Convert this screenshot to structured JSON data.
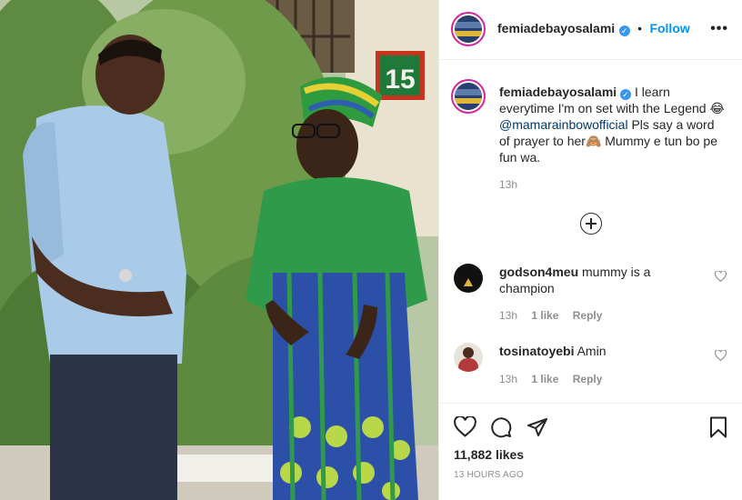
{
  "post": {
    "username": "femiadebayosalami",
    "verified_glyph": "✓",
    "dot": "•",
    "follow_label": "Follow",
    "more_label": "•••",
    "house_number": "15",
    "caption_before": "I learn everytime I'm on set with the Legend 😂 ",
    "caption_mention": "@mamarainbowofficial",
    "caption_after": " Pls say a word of prayer to her🙈 Mummy e tun bo pe fun wa.",
    "caption_time": "13h",
    "load_more_icon": "plus-circle-icon"
  },
  "comments": [
    {
      "username": "godson4meu",
      "text": "mummy is a champion",
      "time": "13h",
      "likes": "1 like",
      "reply": "Reply"
    },
    {
      "username": "tosinatoyebi",
      "text": "Amin",
      "time": "13h",
      "likes": "1 like",
      "reply": "Reply"
    }
  ],
  "actions": {
    "icons": [
      "heart-icon",
      "comment-icon",
      "share-icon",
      "bookmark-icon"
    ],
    "likes": "11,882 likes",
    "posted": "13 HOURS AGO"
  },
  "colors": {
    "accent": "#0095f6",
    "verified": "#3897f0",
    "mention": "#00376b",
    "muted": "#8e8e8e"
  }
}
